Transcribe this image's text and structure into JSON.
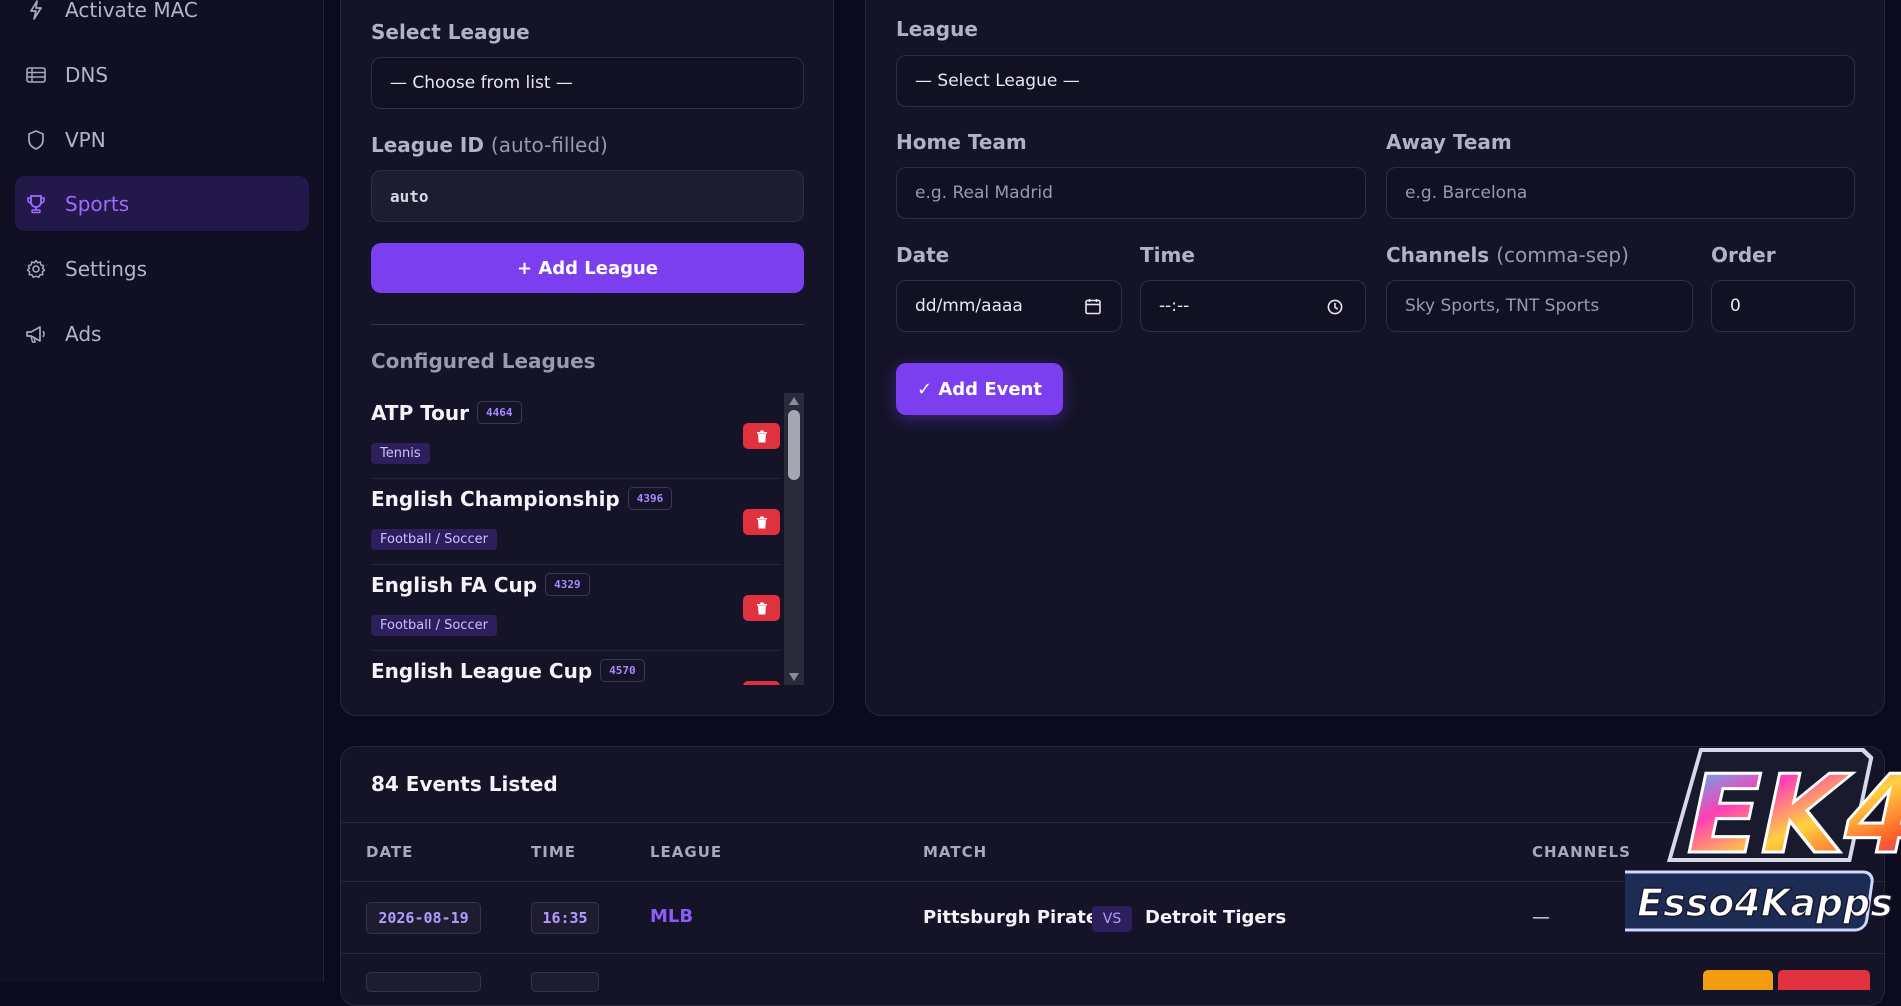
{
  "sidebar": {
    "items": [
      {
        "label": "Activate MAC",
        "icon": "bolt-icon"
      },
      {
        "label": "DNS",
        "icon": "list-icon"
      },
      {
        "label": "VPN",
        "icon": "shield-icon"
      },
      {
        "label": "Sports",
        "icon": "trophy-icon",
        "active": true
      },
      {
        "label": "Settings",
        "icon": "gear-icon"
      },
      {
        "label": "Ads",
        "icon": "megaphone-icon"
      }
    ]
  },
  "league_form": {
    "select_label": "Select League",
    "select_value": "— Choose from list —",
    "id_label": "League ID",
    "id_label_hint": "(auto-filled)",
    "id_value": "auto",
    "add_button": "+ Add League",
    "configured_title": "Configured Leagues",
    "leagues": [
      {
        "name": "ATP Tour",
        "id": "4464",
        "sport": "Tennis"
      },
      {
        "name": "English Championship",
        "id": "4396",
        "sport": "Football / Soccer"
      },
      {
        "name": "English FA Cup",
        "id": "4329",
        "sport": "Football / Soccer"
      },
      {
        "name": "English League Cup",
        "id": "4570",
        "sport": ""
      }
    ]
  },
  "event_form": {
    "league_label": "League",
    "league_value": "— Select League —",
    "home_label": "Home Team",
    "home_placeholder": "e.g. Real Madrid",
    "away_label": "Away Team",
    "away_placeholder": "e.g. Barcelona",
    "date_label": "Date",
    "date_value": "dd/mm/aaaa",
    "time_label": "Time",
    "time_value": "--:--",
    "channels_label": "Channels",
    "channels_hint": "(comma-sep)",
    "channels_placeholder": "Sky Sports, TNT Sports",
    "order_label": "Order",
    "order_value": "0",
    "add_button": "✓ Add Event"
  },
  "events": {
    "count_title": "84 Events Listed",
    "columns": [
      "DATE",
      "TIME",
      "LEAGUE",
      "MATCH",
      "CHANNELS"
    ],
    "rows": [
      {
        "date": "2026-08-19",
        "time": "16:35",
        "league": "MLB",
        "home": "Pittsburgh Pirates",
        "vs": "VS",
        "away": "Detroit Tigers",
        "channels": "—"
      }
    ]
  },
  "watermark": {
    "text": "EK4",
    "subtext": "Esso4Kapps"
  },
  "colors": {
    "accent": "#7b3ff0",
    "danger": "#e0313e",
    "background": "#0c0b1d"
  }
}
